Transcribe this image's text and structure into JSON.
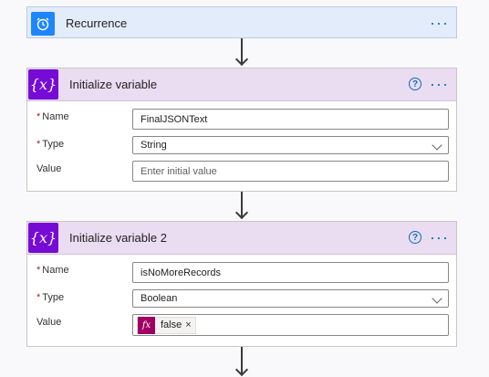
{
  "recurrence": {
    "title": "Recurrence"
  },
  "var1": {
    "title": "Initialize variable",
    "name_label": "Name",
    "name_value": "FinalJSONText",
    "type_label": "Type",
    "type_value": "String",
    "value_label": "Value",
    "value_placeholder": "Enter initial value"
  },
  "var2": {
    "title": "Initialize variable 2",
    "name_label": "Name",
    "name_value": "isNoMoreRecords",
    "type_label": "Type",
    "type_value": "Boolean",
    "value_label": "Value",
    "value_token": "false",
    "token_fx": "fx",
    "token_remove": "×"
  },
  "common": {
    "more_dots": "···",
    "help": "?",
    "required_mark": "*"
  },
  "colors": {
    "recurrence_accent": "#1f85ff",
    "variable_accent": "#770bd6",
    "expression_accent": "#a10063",
    "link_blue": "#0f6cbd"
  },
  "icons": [
    "alarm-clock-icon",
    "variable-icon",
    "help-icon",
    "more-icon",
    "chevron-down-icon",
    "fx-icon",
    "close-icon",
    "arrow-down-icon"
  ]
}
